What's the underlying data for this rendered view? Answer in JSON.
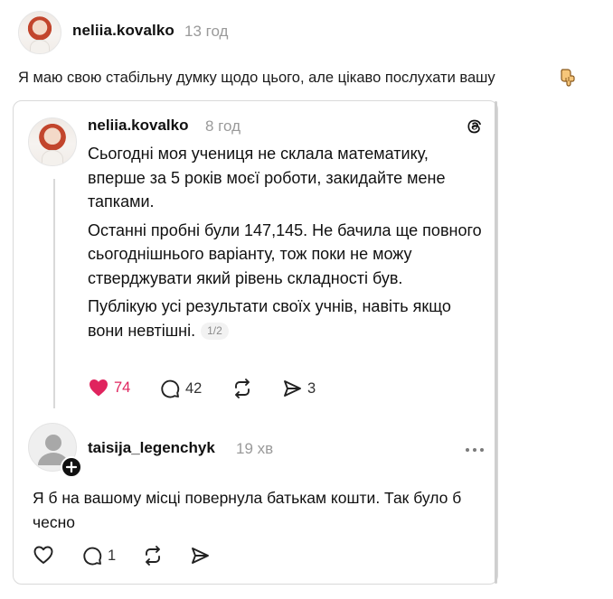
{
  "outer_post": {
    "username": "neliia.kovalko",
    "time": "13 год",
    "text": "Я маю свою стабільну думку щодо цього, але цікаво послухати вашу"
  },
  "quoted_post": {
    "username": "neliia.kovalko",
    "time": "8 год",
    "paragraphs": [
      "Сьогодні моя учениця не склала математику, вперше за 5 років моєї роботи, закидайте мене тапками.",
      "Останні пробні були 147,145. Не бачила ще повного сьогоднішнього варіанту, тож поки не можу стверджувати який рівень складності був.",
      "Публікую усі результати своїх учнів, навіть якщо вони невтішні."
    ],
    "page_indicator": "1/2",
    "likes": "74",
    "comments": "42",
    "shares": "3",
    "liked": true
  },
  "reply": {
    "username": "taisija_legenchyk",
    "time": "19 хв",
    "text": "Я б на вашому місці повернула батькам кошти.  Так було б чесно",
    "comments": "1"
  },
  "colors": {
    "like_red": "#e0245e",
    "muted": "#9a9a9a",
    "border": "#d9d9d9"
  },
  "icons": [
    "hand-point-down-icon",
    "threads-logo-icon",
    "heart-icon",
    "comment-icon",
    "repost-icon",
    "share-icon",
    "more-icon",
    "follow-plus-icon"
  ]
}
